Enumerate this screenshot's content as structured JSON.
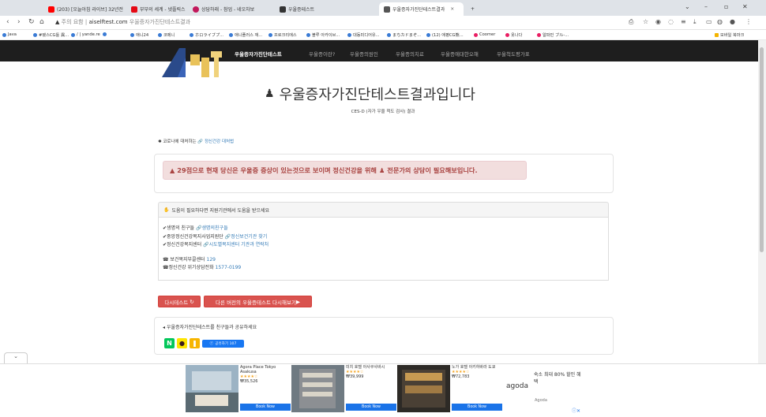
{
  "browser": {
    "tabs": [
      {
        "label": "(203) [오늘아침 라이브] 32년전",
        "color": "#ff0000",
        "active": false
      },
      {
        "label": "부부의 세계 - 넷플릭스",
        "color": "#e50914",
        "active": false
      },
      {
        "label": "상담하래 - 참업 - 네오차보",
        "color": "#c2185b",
        "active": false
      },
      {
        "label": "우울증테스트",
        "color": "#333333",
        "active": false
      },
      {
        "label": "우울증자가진단테스트결과",
        "color": "#555555",
        "active": true
      }
    ],
    "new_tab": "+",
    "url_prefix": "주의 요함",
    "url_domain": "aiselftest.com",
    "url_path": "우울증자가진단테스트결과",
    "bookmarks": [
      {
        "label": "Java",
        "color": "#3a7bd5"
      },
      {
        "label": "#됐스CG툴 異...",
        "color": "#3a7bd5"
      },
      {
        "label": "/ | yande.re",
        "color": "#3a7bd5"
      },
      {
        "label": "",
        "color": "#3a7bd5"
      },
      {
        "label": "애니24",
        "color": "#3a7bd5"
      },
      {
        "label": "코메니",
        "color": "#3a7bd5"
      },
      {
        "label": "ホロライブプ...",
        "color": "#3a7bd5"
      },
      {
        "label": "애니플러스 재...",
        "color": "#3a7bd5"
      },
      {
        "label": "프로크리에스",
        "color": "#3a7bd5"
      },
      {
        "label": "블루 아카이브...",
        "color": "#3a7bd5"
      },
      {
        "label": "대동미디어유...",
        "color": "#3a7bd5"
      },
      {
        "label": "まちカドまぞ...",
        "color": "#3a7bd5"
      },
      {
        "label": "(12) 애평CG熊...",
        "color": "#3a7bd5"
      },
      {
        "label": "Coomer",
        "color": "#e91e63"
      },
      {
        "label": "옷나다",
        "color": "#e91e63"
      },
      {
        "label": "알파민 ブル-...",
        "color": "#e91e63"
      }
    ],
    "mobile_bookmarks": "모바일 북마크"
  },
  "site_nav": {
    "links": [
      {
        "label": "우울증자가진단테스트",
        "active": true
      },
      {
        "label": "우울증이란?",
        "active": false
      },
      {
        "label": "우울증의원인",
        "active": false
      },
      {
        "label": "우울증의치료",
        "active": false
      },
      {
        "label": "우울증에대한오해",
        "active": false
      },
      {
        "label": "우울척도평가표",
        "active": false
      }
    ]
  },
  "result": {
    "title": "우울증자가진단테스트결과입니다",
    "subtitle": "CES-D (자가 우울 척도 검사) 결과",
    "note_prefix": "코로나에 대처하는",
    "note_link": "정신건강 대처법",
    "alert": "29점으로 현재 당신은 우울증 증상이 있는것으로 보이며 정신건강을 위해",
    "alert_suffix": "전문가의 상담이 필요해보입니다."
  },
  "help": {
    "heading": "도움이 필요하다면 지원기관에서 도움을 받으세요",
    "items": [
      {
        "label": "생명의 친구들",
        "link": "생명의친구들"
      },
      {
        "label": "중앙정신건강복지사업지원단",
        "link": "정신보건기관 찾기"
      },
      {
        "label": "정신건강복지센터",
        "link": "시도별복지센터 기관과 연락처"
      }
    ],
    "phones": [
      {
        "label": "보건복지부콜센터",
        "number": "129"
      },
      {
        "label": "정신건강 위기상담전화",
        "number": "1577-0199"
      }
    ]
  },
  "buttons": {
    "retest": "다시테스트",
    "other_version": "다른 버전의 우울증테스트 다시해보기"
  },
  "share": {
    "text": "우울증자가진단테스트를 친구들과 공유하세요",
    "fb_label": "공유하기 107"
  },
  "ads": [
    {
      "name": "Agora Place Tokyo Asakusa",
      "price": "₩35,526",
      "stars": "★★★★☆",
      "cta": "Book Now"
    },
    {
      "name": "미치 호텔 아사쿠사바시",
      "price": "₩39,999",
      "stars": "★★★★☆",
      "cta": "Book Now"
    },
    {
      "name": "노가 호텔 아키하바라 도쿄",
      "price": "₩72,783",
      "stars": "★★★★☆",
      "cta": "Book Now"
    }
  ],
  "agoda": {
    "promo": "숙소 최대 80% 할인 혜택",
    "brand": "agoda",
    "small": "Agoda"
  }
}
